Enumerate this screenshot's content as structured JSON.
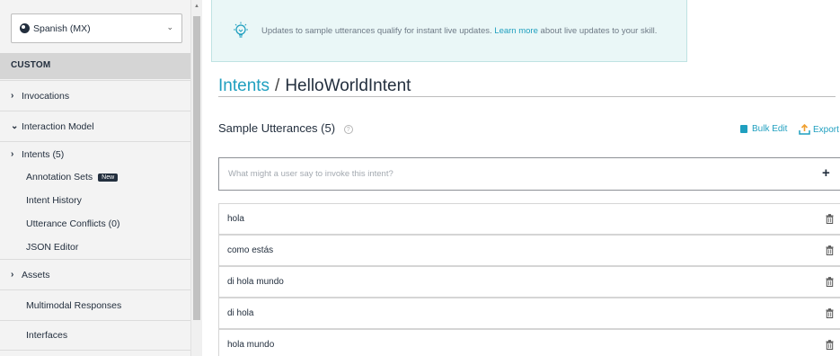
{
  "sidebar": {
    "locale": "Spanish (MX)",
    "section_title": "CUSTOM",
    "items": [
      {
        "label": "Invocations",
        "arrow": "›"
      },
      {
        "label": "Interaction Model",
        "arrow": "⌄"
      },
      {
        "label": "Intents (5)",
        "arrow": "›"
      },
      {
        "label": "Annotation Sets",
        "badge": "New"
      },
      {
        "label": "Intent History"
      },
      {
        "label": "Utterance Conflicts (0)"
      },
      {
        "label": "JSON Editor"
      },
      {
        "label": "Assets",
        "arrow": "›"
      },
      {
        "label": "Multimodal Responses"
      },
      {
        "label": "Interfaces"
      }
    ]
  },
  "banner": {
    "text_before": "Updates to sample utterances qualify for instant live updates. ",
    "link": "Learn more",
    "text_after": " about live updates to your skill."
  },
  "breadcrumb": {
    "parent": "Intents",
    "separator": "/",
    "current": "HelloWorldIntent"
  },
  "utterances": {
    "title": "Sample Utterances (5)",
    "help": "?",
    "bulk_edit": "Bulk Edit",
    "export": "Export",
    "placeholder": "What might a user say to invoke this intent?",
    "add": "+",
    "items": [
      "hola",
      "como estás",
      "di hola mundo",
      "di hola",
      "hola mundo"
    ]
  },
  "colors": {
    "accent": "#1f9fbf",
    "text": "#232f3e",
    "sidebar_bg": "#f3f3f3",
    "banner_bg": "#eaf7f7"
  }
}
